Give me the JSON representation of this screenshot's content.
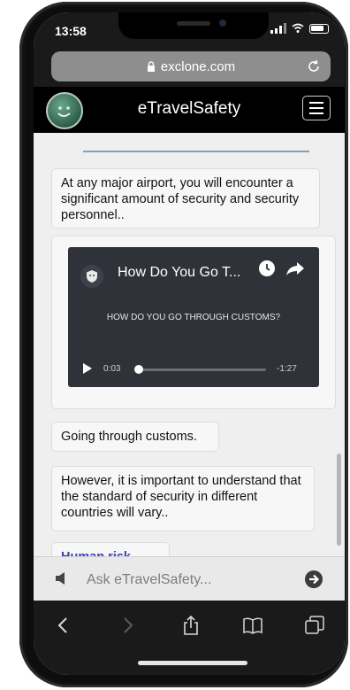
{
  "status_bar": {
    "time": "13:58"
  },
  "browser": {
    "url": "exclone.com"
  },
  "header": {
    "title": "eTravelSafety"
  },
  "messages": [
    {
      "text": "At any major airport, you will encounter a significant amount of security and security personnel.."
    },
    {
      "text": "Going through customs."
    },
    {
      "text": "However, it is important to understand that the standard of security in different countries will vary.."
    },
    {
      "text": "Human risk"
    }
  ],
  "video": {
    "title": "How Do You Go T...",
    "caption": "HOW DO YOU GO THROUGH CUSTOMS?",
    "elapsed": "0:03",
    "remaining": "-1:27",
    "progress": 0.03
  },
  "input": {
    "placeholder": "Ask eTravelSafety..."
  },
  "colors": {
    "header_bg": "#000000",
    "chat_bg": "#efefef",
    "accent_line": "#7fa4b6"
  },
  "icons": [
    "lock-icon",
    "reload-icon",
    "menu-icon",
    "play-icon",
    "clock-icon",
    "share-icon",
    "speaker-icon",
    "send-icon",
    "back-icon",
    "forward-icon",
    "share-page-icon",
    "bookmarks-icon",
    "tabs-icon"
  ]
}
